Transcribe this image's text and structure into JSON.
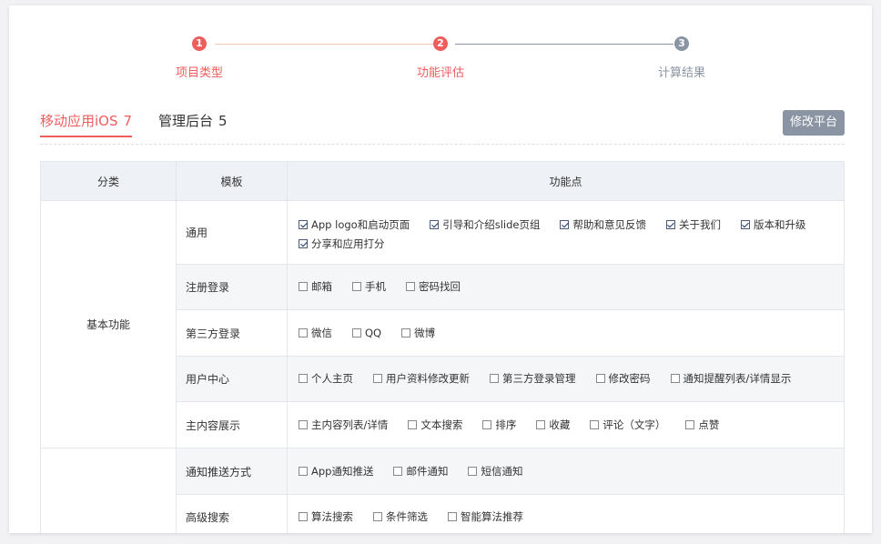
{
  "stepper": {
    "steps": [
      {
        "num": "1",
        "label": "项目类型",
        "color": "#ef5d5d"
      },
      {
        "num": "2",
        "label": "功能评估",
        "color": "#ef5d5d"
      },
      {
        "num": "3",
        "label": "计算结果",
        "color": "#8a94a3"
      }
    ],
    "line_colors": [
      "#f2c6b6",
      "#8a94a3"
    ]
  },
  "tabs": [
    {
      "label": "移动应用iOS",
      "count": "7",
      "active": true
    },
    {
      "label": "管理后台",
      "count": "5",
      "active": false
    }
  ],
  "edit_button": "修改平台",
  "table": {
    "headers": [
      "分类",
      "模板",
      "功能点"
    ],
    "categories": [
      "基本功能",
      ""
    ],
    "rows": [
      {
        "module": "通用",
        "options": [
          {
            "label": "App logo和启动页面",
            "checked": true
          },
          {
            "label": "引导和介绍slide页组",
            "checked": true
          },
          {
            "label": "帮助和意见反馈",
            "checked": true
          },
          {
            "label": "关于我们",
            "checked": true
          },
          {
            "label": "版本和升级",
            "checked": true
          },
          {
            "label": "分享和应用打分",
            "checked": true
          }
        ]
      },
      {
        "module": "注册登录",
        "options": [
          {
            "label": "邮箱",
            "checked": false
          },
          {
            "label": "手机",
            "checked": false
          },
          {
            "label": "密码找回",
            "checked": false
          }
        ]
      },
      {
        "module": "第三方登录",
        "options": [
          {
            "label": "微信",
            "checked": false
          },
          {
            "label": "QQ",
            "checked": false
          },
          {
            "label": "微博",
            "checked": false
          }
        ]
      },
      {
        "module": "用户中心",
        "options": [
          {
            "label": "个人主页",
            "checked": false
          },
          {
            "label": "用户资料修改更新",
            "checked": false
          },
          {
            "label": "第三方登录管理",
            "checked": false
          },
          {
            "label": "修改密码",
            "checked": false
          },
          {
            "label": "通知提醒列表/详情显示",
            "checked": false
          }
        ]
      },
      {
        "module": "主内容展示",
        "options": [
          {
            "label": "主内容列表/详情",
            "checked": false
          },
          {
            "label": "文本搜索",
            "checked": false
          },
          {
            "label": "排序",
            "checked": false
          },
          {
            "label": "收藏",
            "checked": false
          },
          {
            "label": "评论（文字）",
            "checked": false
          },
          {
            "label": "点赞",
            "checked": false
          }
        ]
      },
      {
        "module": "通知推送方式",
        "options": [
          {
            "label": "App通知推送",
            "checked": false
          },
          {
            "label": "邮件通知",
            "checked": false
          },
          {
            "label": "短信通知",
            "checked": false
          }
        ]
      },
      {
        "module": "高级搜索",
        "options": [
          {
            "label": "算法搜索",
            "checked": false
          },
          {
            "label": "条件筛选",
            "checked": false
          },
          {
            "label": "智能算法推荐",
            "checked": false
          }
        ]
      }
    ]
  }
}
